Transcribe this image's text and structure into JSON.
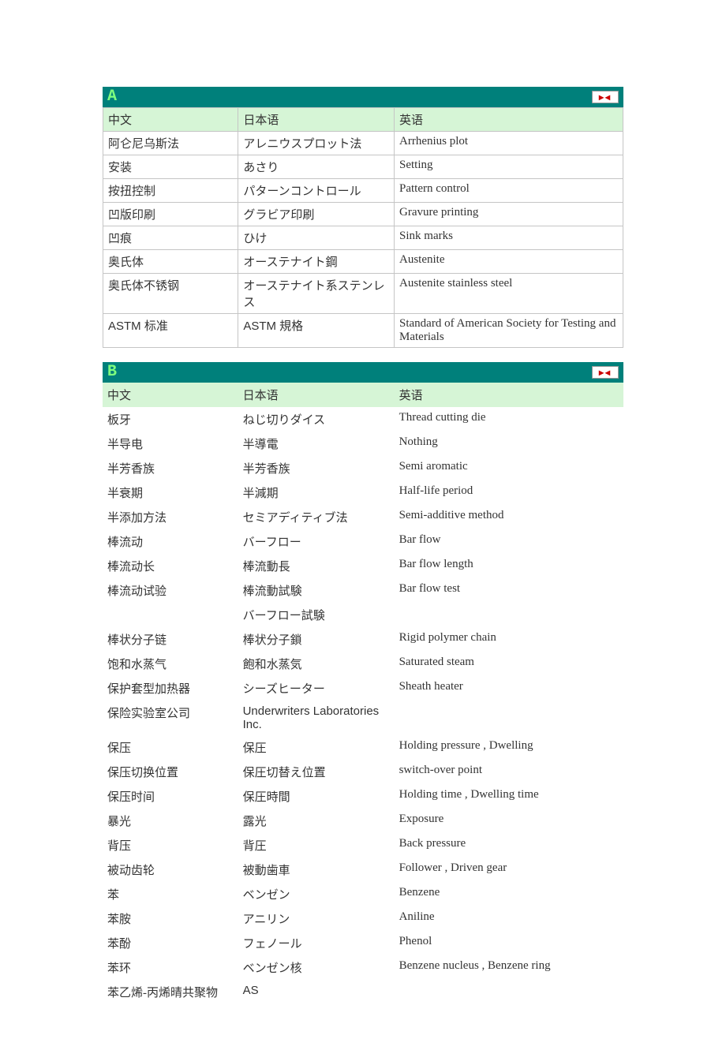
{
  "headers": {
    "cn": "中文",
    "jp": "日本语",
    "en": "英语"
  },
  "sections": [
    {
      "letter": "A",
      "bordered": true,
      "rows": [
        {
          "cn": "阿仑尼乌斯法",
          "jp": "アレニウスプロット法",
          "en": "Arrhenius plot"
        },
        {
          "cn": "安装",
          "jp": "あさり",
          "en": "Setting"
        },
        {
          "cn": "按扭控制",
          "jp": "パターンコントロール",
          "en": "Pattern control"
        },
        {
          "cn": "凹版印刷",
          "jp": "グラビア印刷",
          "en": "Gravure printing"
        },
        {
          "cn": "凹痕",
          "jp": "ひけ",
          "en": "Sink marks"
        },
        {
          "cn": "奥氏体",
          "jp": "オーステナイト鋼",
          "en": "Austenite"
        },
        {
          "cn": "奥氏体不锈钢",
          "jp": "オーステナイト系ステンレス",
          "en": "Austenite stainless steel"
        },
        {
          "cn": "ASTM 标准",
          "jp": "ASTM 規格",
          "en": "Standard of American Society for Testing and Materials",
          "cnSans": true,
          "jpSans": true
        }
      ]
    },
    {
      "letter": "B",
      "bordered": false,
      "rows": [
        {
          "cn": "板牙",
          "jp": "ねじ切りダイス",
          "en": "Thread cutting die"
        },
        {
          "cn": "半导电",
          "jp": "半導電",
          "en": "Nothing"
        },
        {
          "cn": "半芳香族",
          "jp": "半芳香族",
          "en": "Semi aromatic"
        },
        {
          "cn": "半衰期",
          "jp": "半減期",
          "en": "Half-life period"
        },
        {
          "cn": "半添加方法",
          "jp": "セミアディティブ法",
          "en": "Semi-additive method"
        },
        {
          "cn": "棒流动",
          "jp": "バーフロー",
          "en": "Bar flow"
        },
        {
          "cn": "棒流动长",
          "jp": "棒流動長",
          "en": "Bar flow length"
        },
        {
          "cn": "棒流动试验",
          "jp": "棒流動試験",
          "en": "Bar flow test"
        },
        {
          "cn": "",
          "jp": "バーフロー試験",
          "en": ""
        },
        {
          "cn": "棒状分子链",
          "jp": "棒状分子鎖",
          "en": "Rigid polymer chain"
        },
        {
          "cn": "饱和水蒸气",
          "jp": "飽和水蒸気",
          "en": "Saturated steam"
        },
        {
          "cn": "保护套型加热器",
          "jp": "シーズヒーター",
          "en": "Sheath heater"
        },
        {
          "cn": "保险实验室公司",
          "jp": "Underwriters Laboratories Inc.",
          "en": "",
          "jpSans": true
        },
        {
          "cn": "保压",
          "jp": "保圧",
          "en": "Holding pressure , Dwelling"
        },
        {
          "cn": "保压切换位置",
          "jp": "保圧切替え位置",
          "en": "switch-over point"
        },
        {
          "cn": "保压时间",
          "jp": "保圧時間",
          "en": "Holding time , Dwelling time"
        },
        {
          "cn": "暴光",
          "jp": "露光",
          "en": "Exposure"
        },
        {
          "cn": "背压",
          "jp": "背圧",
          "en": "Back pressure"
        },
        {
          "cn": "被动齿轮",
          "jp": "被動歯車",
          "en": "Follower , Driven gear"
        },
        {
          "cn": "苯",
          "jp": "ベンゼン",
          "en": "Benzene"
        },
        {
          "cn": "苯胺",
          "jp": "アニリン",
          "en": "Aniline"
        },
        {
          "cn": "苯酚",
          "jp": "フェノール",
          "en": "Phenol"
        },
        {
          "cn": "苯环",
          "jp": "ベンゼン核",
          "en": "Benzene nucleus , Benzene ring"
        },
        {
          "cn": "苯乙烯-丙烯晴共聚物",
          "jp": "AS",
          "en": "",
          "jpSans": true
        }
      ]
    }
  ]
}
